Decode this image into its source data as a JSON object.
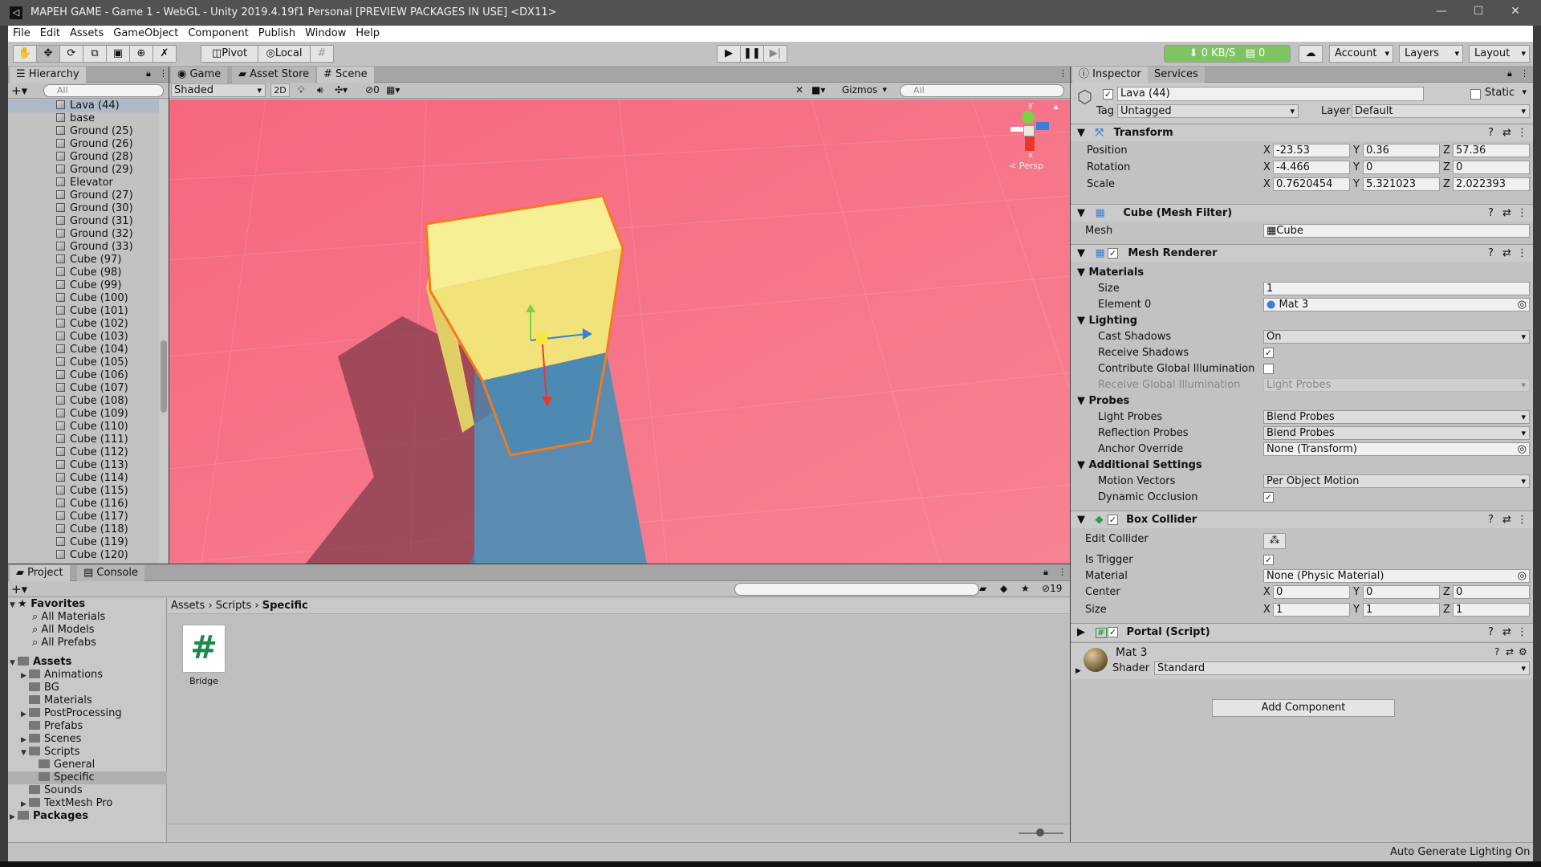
{
  "window": {
    "title": "MAPEH GAME - Game 1 - WebGL - Unity 2019.4.19f1 Personal [PREVIEW PACKAGES IN USE] <DX11>",
    "icon": "unity-logo-icon"
  },
  "menu": [
    "File",
    "Edit",
    "Assets",
    "GameObject",
    "Component",
    "Publish",
    "Window",
    "Help"
  ],
  "toolbar": {
    "pivot": "Pivot",
    "local": "Local",
    "cloud": "0 KB/S",
    "cloud_count": "0",
    "account": "Account",
    "layers": "Layers",
    "layout": "Layout"
  },
  "hierarchy": {
    "tab": "Hierarchy",
    "search_placeholder": "All",
    "items": [
      "Lava (44)",
      "base",
      "Ground (25)",
      "Ground (26)",
      "Ground (28)",
      "Ground (29)",
      "Elevator",
      "Ground (27)",
      "Ground (30)",
      "Ground (31)",
      "Ground (32)",
      "Ground (33)",
      "Cube (97)",
      "Cube (98)",
      "Cube (99)",
      "Cube (100)",
      "Cube (101)",
      "Cube (102)",
      "Cube (103)",
      "Cube (104)",
      "Cube (105)",
      "Cube (106)",
      "Cube (107)",
      "Cube (108)",
      "Cube (109)",
      "Cube (110)",
      "Cube (111)",
      "Cube (112)",
      "Cube (113)",
      "Cube (114)",
      "Cube (115)",
      "Cube (116)",
      "Cube (117)",
      "Cube (118)",
      "Cube (119)",
      "Cube (120)"
    ]
  },
  "scene": {
    "tabs": [
      "Game",
      "Asset Store",
      "Scene"
    ],
    "shading": "Shaded",
    "mode2d": "2D",
    "hidden_count": "0",
    "gizmos": "Gizmos",
    "search_placeholder": "All",
    "persp": "< Persp",
    "axis_y": "y",
    "axis_x": "x",
    "bg_color": "#f26a7e",
    "cube_color": "#f5e57a"
  },
  "project": {
    "tabs": [
      "Project",
      "Console"
    ],
    "favorites_label": "Favorites",
    "favorites": [
      "All Materials",
      "All Models",
      "All Prefabs"
    ],
    "assets_label": "Assets",
    "assets": [
      "Animations",
      "BG",
      "Materials",
      "PostProcessing",
      "Prefabs",
      "Scenes",
      "Scripts",
      "General",
      "Specific",
      "Sounds",
      "TextMesh Pro"
    ],
    "packages_label": "Packages",
    "breadcrumb": [
      "Assets",
      "Scripts",
      "Specific"
    ],
    "file_name": "Bridge",
    "file_icon": "#",
    "visible_count": "19"
  },
  "inspector": {
    "tabs": [
      "Inspector",
      "Services"
    ],
    "object_name": "Lava (44)",
    "static_label": "Static",
    "tag_label": "Tag",
    "tag_value": "Untagged",
    "layer_label": "Layer",
    "layer_value": "Default",
    "transform": {
      "title": "Transform",
      "position_label": "Position",
      "rotation_label": "Rotation",
      "scale_label": "Scale",
      "position": [
        "-23.53",
        "0.36",
        "57.36"
      ],
      "rotation": [
        "-4.466",
        "0",
        "0"
      ],
      "scale": [
        "0.7620454",
        "5.321023",
        "2.022393"
      ]
    },
    "mesh_filter": {
      "title": "Cube (Mesh Filter)",
      "mesh_label": "Mesh",
      "mesh_value": "Cube"
    },
    "mesh_renderer": {
      "title": "Mesh Renderer",
      "materials_label": "Materials",
      "size_label": "Size",
      "size_value": "1",
      "element0_label": "Element 0",
      "element0_value": "Mat 3",
      "lighting_label": "Lighting",
      "cast_shadows_label": "Cast Shadows",
      "cast_shadows_value": "On",
      "receive_shadows_label": "Receive Shadows",
      "contribute_gi_label": "Contribute Global Illumination",
      "receive_gi_label": "Receive Global Illumination",
      "receive_gi_value": "Light Probes",
      "probes_label": "Probes",
      "light_probes_label": "Light Probes",
      "light_probes_value": "Blend Probes",
      "reflection_probes_label": "Reflection Probes",
      "reflection_probes_value": "Blend Probes",
      "anchor_label": "Anchor Override",
      "anchor_value": "None (Transform)",
      "additional_label": "Additional Settings",
      "motion_label": "Motion Vectors",
      "motion_value": "Per Object Motion",
      "occlusion_label": "Dynamic Occlusion"
    },
    "box_collider": {
      "title": "Box Collider",
      "edit_label": "Edit Collider",
      "trigger_label": "Is Trigger",
      "material_label": "Material",
      "material_value": "None (Physic Material)",
      "center_label": "Center",
      "center": [
        "0",
        "0",
        "0"
      ],
      "size_label": "Size",
      "size": [
        "1",
        "1",
        "1"
      ]
    },
    "portal": {
      "title": "Portal (Script)"
    },
    "material": {
      "name": "Mat 3",
      "shader_label": "Shader",
      "shader_value": "Standard"
    },
    "add_component": "Add Component"
  },
  "statusbar": {
    "text": "Auto Generate Lighting On"
  }
}
